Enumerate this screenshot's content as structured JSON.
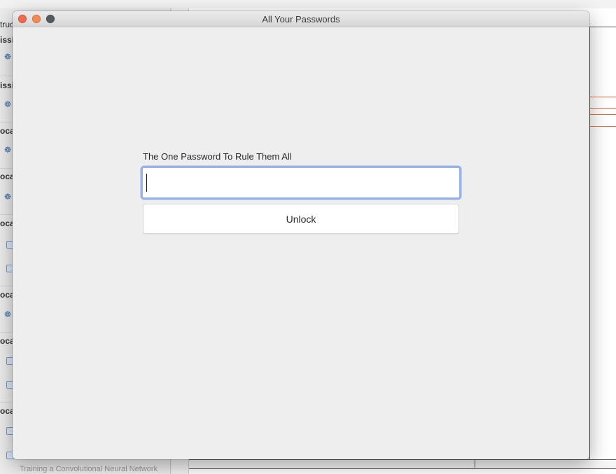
{
  "window": {
    "title": "All Your Passwords"
  },
  "form": {
    "label": "The One Password To Rule Them All",
    "password_value": "",
    "unlock_label": "Unlock"
  },
  "background": {
    "left_header": "truc",
    "sections": [
      "issi",
      "issi",
      "ocal",
      "ocal",
      "ocal",
      "ocal",
      "ocal",
      "ocal"
    ],
    "bottom_caption": "Training a Convolutional Neural Network"
  },
  "colors": {
    "close": "#f06a50",
    "minimize": "#f48a52",
    "zoom": "#535b61",
    "focus_ring": "#7a9ee0"
  }
}
